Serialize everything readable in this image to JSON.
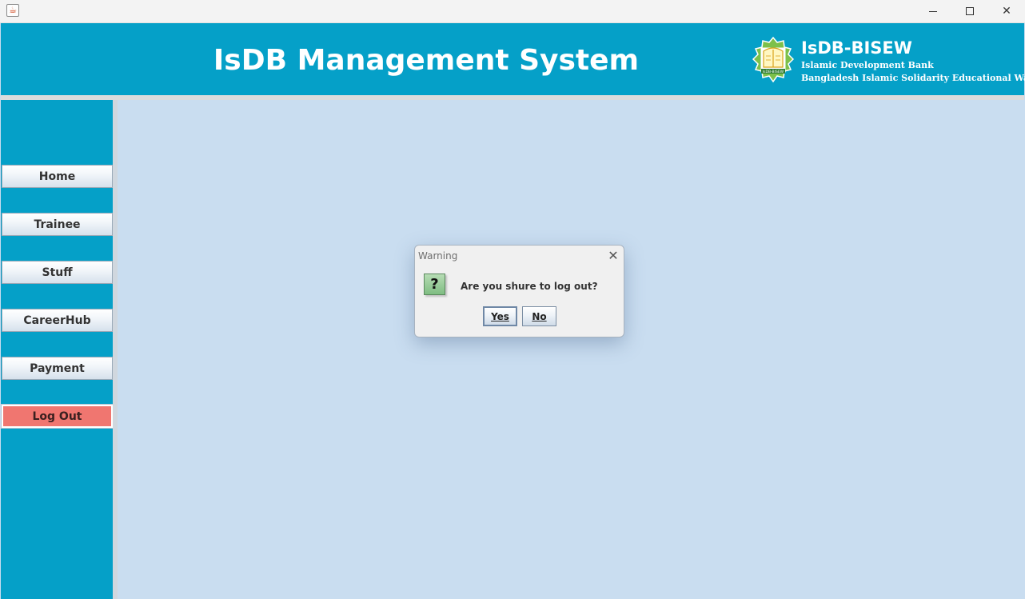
{
  "titlebar": {
    "app_icon": "java-cup-icon",
    "minimize_icon": "minimize-icon",
    "maximize_icon": "maximize-icon",
    "close_icon": "close-icon",
    "close_glyph": "✕"
  },
  "header": {
    "title": "IsDB Management System",
    "logo_icon": "isdb-bisew-logo",
    "logo_text": "IsDB-BISEW",
    "brand_name": "IsDB-BISEW",
    "brand_line1": "Islamic Development Bank",
    "brand_line2": "Bangladesh Islamic Solidarity Educational Wakf",
    "bg_color": "#05a0c8"
  },
  "sidebar": {
    "items": [
      {
        "label": "Home"
      },
      {
        "label": "Trainee"
      },
      {
        "label": "Stuff"
      },
      {
        "label": "CareerHub"
      },
      {
        "label": "Payment"
      },
      {
        "label": "Log Out"
      }
    ],
    "logout_color": "#f07670"
  },
  "content": {
    "bg_color": "#c9ddf0"
  },
  "dialog": {
    "title": "Warning",
    "close_glyph": "✕",
    "icon": "question-icon",
    "icon_glyph": "?",
    "message": "Are you shure to log out?",
    "yes_label": "Yes",
    "no_label": "No"
  }
}
